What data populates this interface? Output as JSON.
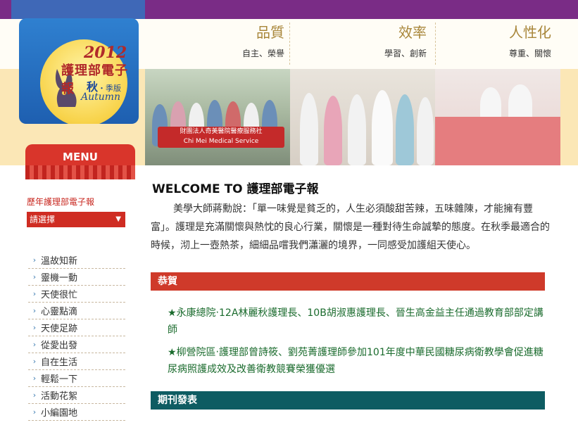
{
  "logo": {
    "year": "2012",
    "name": "護理部電子報",
    "season": "秋",
    "season_suffix": "・季版",
    "season_en": "Autumn"
  },
  "slogans": [
    {
      "title": "品質",
      "sub": "自主、榮譽"
    },
    {
      "title": "效率",
      "sub": "學習、創新"
    },
    {
      "title": "人性化",
      "sub": "尊重、關懷"
    }
  ],
  "photo_banner": {
    "line1": "財團法人奇美醫院醫療服務社",
    "line2": "Chi Mei Medical Service"
  },
  "menu": {
    "title": "MENU",
    "archive_label": "歷年護理部電子報",
    "select_value": "請選擇",
    "items": [
      "溫故知新",
      "靈機一動",
      "天使很忙",
      "心靈點滴",
      "天使足跡",
      "從愛出發",
      "自在生活",
      "輕鬆一下",
      "活動花絮",
      "小編園地"
    ]
  },
  "main": {
    "welcome": "WELCOME TO 護理部電子報",
    "intro": "美學大師蔣勳說：「單一味覺是貧乏的，人生必須酸甜苦辣，五味雜陳，才能擁有豐富」。護理是充滿關懷與熱忱的良心行業，關懷是一種對待生命誠摯的態度。在秋季最適合的時候，沏上一壺熱茶，細細品嚐我們瀟灑的境界，一同感受加護組天使心。",
    "section_congrats": "恭賀",
    "news": [
      "永康總院‧12A林麗秋護理長、10B胡淑惠護理長、晉生高金益主任通過教育部部定講師",
      "柳營院區‧護理部曾詩筱、劉苑菁護理師參加101年度中華民國糖尿病衛教學會促進糖尿病照護成效及改善衛教競賽榮獲優選"
    ],
    "section_publications": "期刊發表"
  },
  "colors": {
    "top_purple": "#7a2c86",
    "logo_blue": "#2f80d0",
    "menu_red": "#d9352b",
    "section_red": "#cf3a2a",
    "section_teal": "#0e5c62",
    "news_green": "#1a6b2d"
  }
}
